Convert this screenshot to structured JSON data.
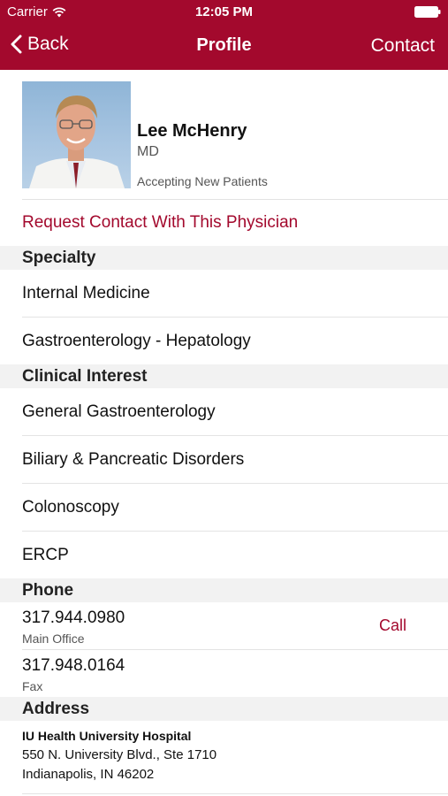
{
  "status_bar": {
    "carrier": "Carrier",
    "time": "12:05 PM",
    "icons": [
      "wifi-icon",
      "battery-icon"
    ]
  },
  "nav": {
    "back_label": "Back",
    "title": "Profile",
    "contact_label": "Contact"
  },
  "colors": {
    "accent": "#a3092d",
    "section_bg": "#f2f2f2"
  },
  "profile": {
    "name": "Lee McHenry",
    "credential": "MD",
    "status": "Accepting New Patients",
    "photo_icon": "doctor-portrait"
  },
  "request_contact_label": "Request Contact With This Physician",
  "specialty": {
    "header": "Specialty",
    "items": [
      "Internal Medicine",
      "Gastroenterology - Hepatology"
    ]
  },
  "clinical_interest": {
    "header": "Clinical Interest",
    "items": [
      "General Gastroenterology",
      "Biliary & Pancreatic Disorders",
      "Colonoscopy",
      "ERCP"
    ]
  },
  "phone": {
    "header": "Phone",
    "entries": [
      {
        "number": "317.944.0980",
        "label": "Main Office",
        "action": "Call"
      },
      {
        "number": "317.948.0164",
        "label": "Fax"
      }
    ]
  },
  "address": {
    "header": "Address",
    "place": "IU Health University Hospital",
    "line1": "550 N. University Blvd., Ste 1710",
    "line2": "Indianapolis, IN 46202"
  }
}
